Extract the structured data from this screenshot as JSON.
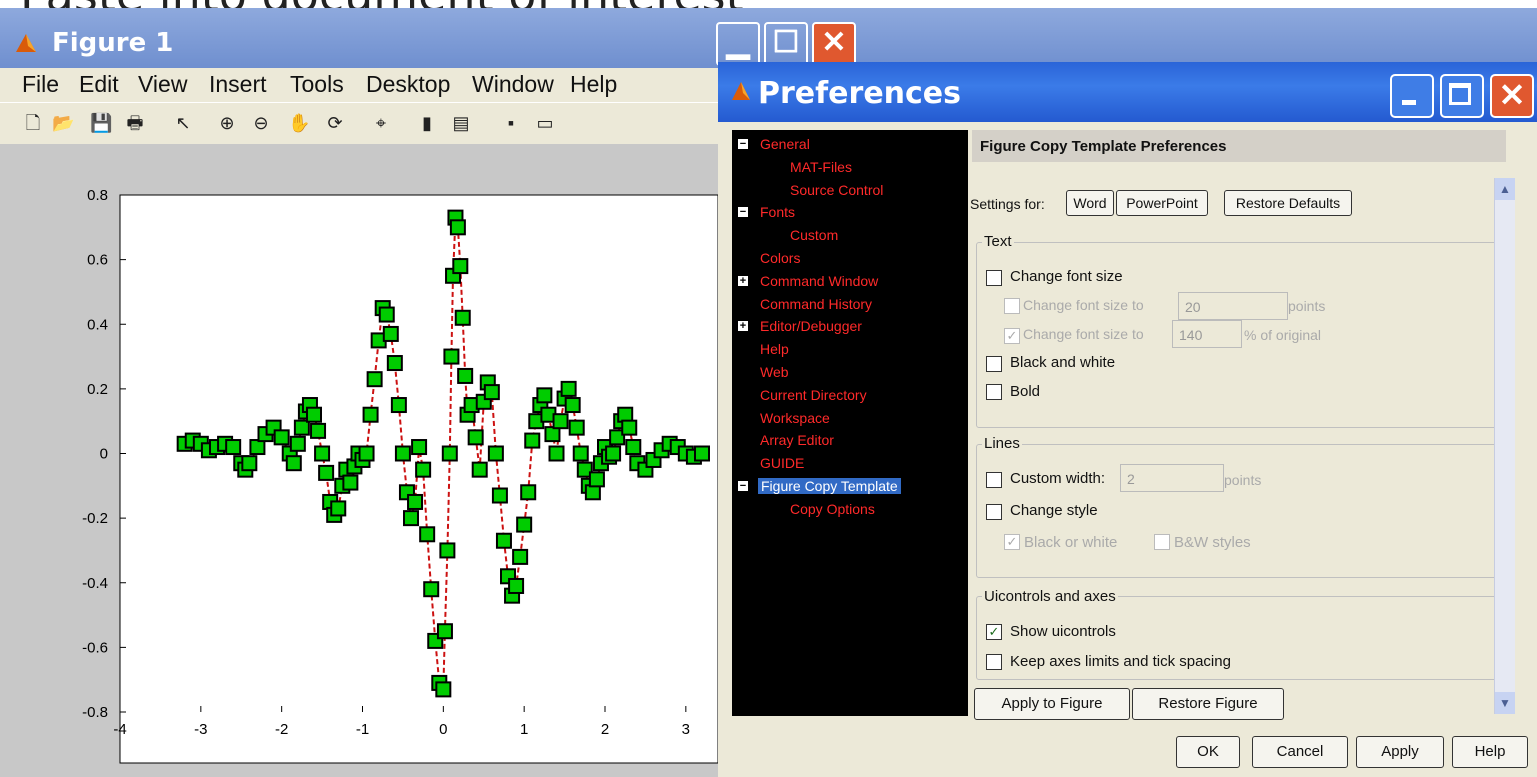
{
  "overlay_text": "Paste into document of interest",
  "figure": {
    "title": "Figure 1",
    "menu": [
      "File",
      "Edit",
      "View",
      "Insert",
      "Tools",
      "Desktop",
      "Window",
      "Help"
    ]
  },
  "preferences": {
    "title": "Preferences",
    "tree": [
      {
        "label": "General",
        "level": 0,
        "toggle": "minus"
      },
      {
        "label": "MAT-Files",
        "level": 1
      },
      {
        "label": "Source Control",
        "level": 1
      },
      {
        "label": "Fonts",
        "level": 0,
        "toggle": "minus"
      },
      {
        "label": "Custom",
        "level": 1
      },
      {
        "label": "Colors",
        "level": 0
      },
      {
        "label": "Command Window",
        "level": 0,
        "toggle": "plus"
      },
      {
        "label": "Command History",
        "level": 0
      },
      {
        "label": "Editor/Debugger",
        "level": 0,
        "toggle": "plus"
      },
      {
        "label": "Help",
        "level": 0
      },
      {
        "label": "Web",
        "level": 0
      },
      {
        "label": "Current Directory",
        "level": 0
      },
      {
        "label": "Workspace",
        "level": 0
      },
      {
        "label": "Array Editor",
        "level": 0
      },
      {
        "label": "GUIDE",
        "level": 0
      },
      {
        "label": "Figure Copy Template",
        "level": 0,
        "toggle": "minus",
        "selected": true
      },
      {
        "label": "Copy Options",
        "level": 1
      }
    ],
    "panel_title": "Figure Copy Template Preferences",
    "settings_for": "Settings for:",
    "word_btn": "Word",
    "powerpoint_btn": "PowerPoint",
    "restore_defaults_btn": "Restore Defaults",
    "text_group": "Text",
    "change_font_size": "Change font size",
    "change_font_size_to": "Change font size to",
    "font_size_value": "20",
    "points": "points",
    "font_pct_value": "140",
    "pct_of_original": "% of original",
    "black_and_white": "Black and white",
    "bold": "Bold",
    "lines_group": "Lines",
    "custom_width": "Custom width:",
    "custom_width_value": "2",
    "change_style": "Change style",
    "black_or_white": "Black or white",
    "bw_styles": "B&W styles",
    "ui_group": "Uicontrols and axes",
    "show_uicontrols": "Show uicontrols",
    "keep_axes": "Keep axes limits and tick spacing",
    "apply_to_figure": "Apply to Figure",
    "restore_figure": "Restore Figure",
    "ok": "OK",
    "cancel": "Cancel",
    "apply": "Apply",
    "help": "Help"
  },
  "chart_data": {
    "type": "scatter",
    "xlim": [
      -4,
      3.2
    ],
    "ylim": [
      -0.8,
      0.8
    ],
    "x_ticks": [
      "-4",
      "-3",
      "-2",
      "-1",
      "0",
      "1",
      "2",
      "3"
    ],
    "y_ticks": [
      "0.8",
      "0.6",
      "0.4",
      "0.2",
      "0",
      "-0.2",
      "-0.4",
      "-0.6",
      "-0.8"
    ],
    "marker_color": "#00cc00",
    "line_color": "#cc1111",
    "series": [
      {
        "function": "sin(4x)*exp(-x^2/4)*... sampled",
        "x_start": -3.2,
        "x_end": 3.2,
        "values": [
          [
            -3.2,
            0.03
          ],
          [
            -3.1,
            0.04
          ],
          [
            -3.0,
            0.03
          ],
          [
            -2.9,
            0.01
          ],
          [
            -2.8,
            0.02
          ],
          [
            -2.7,
            0.03
          ],
          [
            -2.6,
            0.02
          ],
          [
            -2.5,
            -0.03
          ],
          [
            -2.45,
            -0.05
          ],
          [
            -2.4,
            -0.03
          ],
          [
            -2.3,
            0.02
          ],
          [
            -2.2,
            0.06
          ],
          [
            -2.1,
            0.08
          ],
          [
            -2.0,
            0.05
          ],
          [
            -1.9,
            0.0
          ],
          [
            -1.85,
            -0.03
          ],
          [
            -1.8,
            0.03
          ],
          [
            -1.75,
            0.08
          ],
          [
            -1.7,
            0.13
          ],
          [
            -1.65,
            0.15
          ],
          [
            -1.6,
            0.12
          ],
          [
            -1.55,
            0.07
          ],
          [
            -1.5,
            0.0
          ],
          [
            -1.45,
            -0.06
          ],
          [
            -1.4,
            -0.15
          ],
          [
            -1.35,
            -0.19
          ],
          [
            -1.3,
            -0.17
          ],
          [
            -1.25,
            -0.1
          ],
          [
            -1.2,
            -0.05
          ],
          [
            -1.15,
            -0.09
          ],
          [
            -1.1,
            -0.04
          ],
          [
            -1.05,
            0.0
          ],
          [
            -1.0,
            -0.02
          ],
          [
            -0.95,
            0.0
          ],
          [
            -0.9,
            0.12
          ],
          [
            -0.85,
            0.23
          ],
          [
            -0.8,
            0.35
          ],
          [
            -0.75,
            0.45
          ],
          [
            -0.7,
            0.43
          ],
          [
            -0.65,
            0.37
          ],
          [
            -0.6,
            0.28
          ],
          [
            -0.55,
            0.15
          ],
          [
            -0.5,
            0.0
          ],
          [
            -0.45,
            -0.12
          ],
          [
            -0.4,
            -0.2
          ],
          [
            -0.35,
            -0.15
          ],
          [
            -0.3,
            0.02
          ],
          [
            -0.25,
            -0.05
          ],
          [
            -0.2,
            -0.25
          ],
          [
            -0.15,
            -0.42
          ],
          [
            -0.1,
            -0.58
          ],
          [
            -0.05,
            -0.71
          ],
          [
            0.0,
            -0.73
          ],
          [
            0.02,
            -0.55
          ],
          [
            0.05,
            -0.3
          ],
          [
            0.08,
            0.0
          ],
          [
            0.1,
            0.3
          ],
          [
            0.12,
            0.55
          ],
          [
            0.15,
            0.73
          ],
          [
            0.18,
            0.7
          ],
          [
            0.21,
            0.58
          ],
          [
            0.24,
            0.42
          ],
          [
            0.27,
            0.24
          ],
          [
            0.3,
            0.12
          ],
          [
            0.35,
            0.15
          ],
          [
            0.4,
            0.05
          ],
          [
            0.45,
            -0.05
          ],
          [
            0.5,
            0.16
          ],
          [
            0.55,
            0.22
          ],
          [
            0.6,
            0.19
          ],
          [
            0.65,
            0.0
          ],
          [
            0.7,
            -0.13
          ],
          [
            0.75,
            -0.27
          ],
          [
            0.8,
            -0.38
          ],
          [
            0.85,
            -0.44
          ],
          [
            0.9,
            -0.41
          ],
          [
            0.95,
            -0.32
          ],
          [
            1.0,
            -0.22
          ],
          [
            1.05,
            -0.12
          ],
          [
            1.1,
            0.04
          ],
          [
            1.15,
            0.1
          ],
          [
            1.2,
            0.15
          ],
          [
            1.25,
            0.18
          ],
          [
            1.3,
            0.12
          ],
          [
            1.35,
            0.06
          ],
          [
            1.4,
            0.0
          ],
          [
            1.45,
            0.1
          ],
          [
            1.5,
            0.17
          ],
          [
            1.55,
            0.2
          ],
          [
            1.6,
            0.15
          ],
          [
            1.65,
            0.08
          ],
          [
            1.7,
            0.0
          ],
          [
            1.75,
            -0.05
          ],
          [
            1.8,
            -0.1
          ],
          [
            1.85,
            -0.12
          ],
          [
            1.9,
            -0.08
          ],
          [
            1.95,
            -0.03
          ],
          [
            2.0,
            0.02
          ],
          [
            2.05,
            -0.01
          ],
          [
            2.1,
            0.0
          ],
          [
            2.15,
            0.05
          ],
          [
            2.2,
            0.1
          ],
          [
            2.25,
            0.12
          ],
          [
            2.3,
            0.08
          ],
          [
            2.35,
            0.02
          ],
          [
            2.4,
            -0.03
          ],
          [
            2.5,
            -0.05
          ],
          [
            2.6,
            -0.02
          ],
          [
            2.7,
            0.01
          ],
          [
            2.8,
            0.03
          ],
          [
            2.9,
            0.02
          ],
          [
            3.0,
            0.0
          ],
          [
            3.1,
            -0.01
          ],
          [
            3.2,
            0.0
          ]
        ]
      }
    ]
  }
}
